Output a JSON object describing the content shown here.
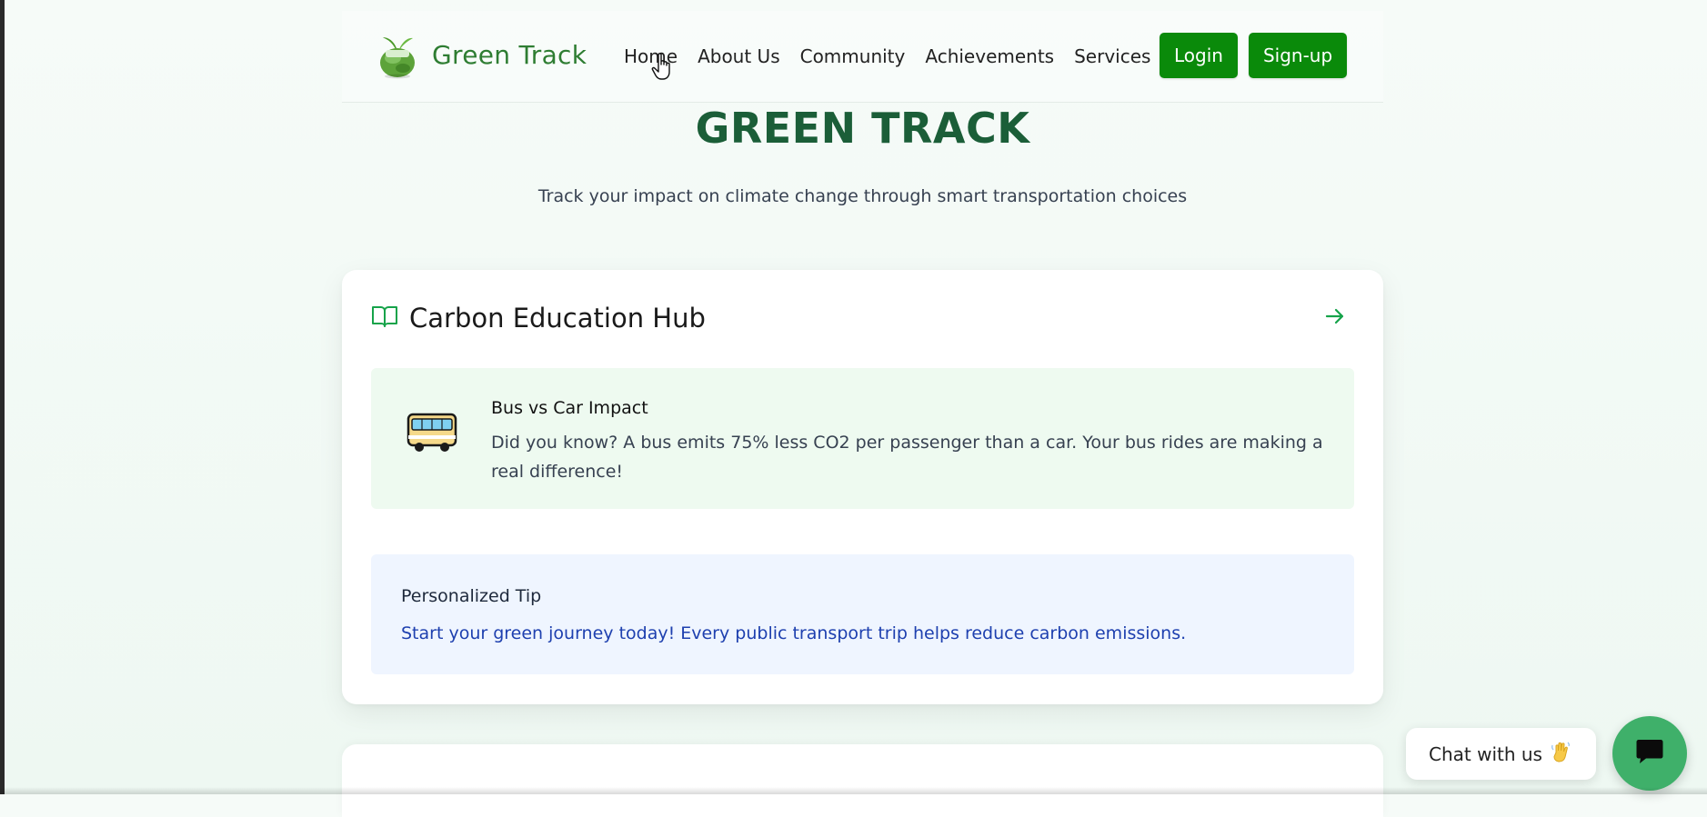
{
  "brand": {
    "name": "Green Track"
  },
  "nav": {
    "links": [
      "Home",
      "About Us",
      "Community",
      "Achievements",
      "Services"
    ],
    "login_label": "Login",
    "signup_label": "Sign-up"
  },
  "hero": {
    "title": "GREEN TRACK",
    "subtitle": "Track your impact on climate change through smart transportation choices"
  },
  "education_hub": {
    "title": "Carbon Education Hub",
    "fact": {
      "title": "Bus vs Car Impact",
      "text": "Did you know? A bus emits 75% less CO2 per passenger than a car. Your bus rides are making a real difference!"
    },
    "tip": {
      "title": "Personalized Tip",
      "text": "Start your green journey today! Every public transport trip helps reduce carbon emissions."
    }
  },
  "chat": {
    "label": "Chat with us"
  },
  "icons": {
    "logo": "globe-leaf-logo",
    "book": "book-open-icon",
    "arrow": "arrow-right-icon",
    "bus": "bus-icon",
    "wave": "waving-hand-icon",
    "chat": "chat-bubble-icon",
    "cursor": "hand-pointer-cursor"
  },
  "colors": {
    "brand_green": "#2e7d32",
    "button_green": "#0a8a0a",
    "title_green": "#1b5e38",
    "fact_bg": "#eefaf0",
    "tip_bg": "#eff5ff",
    "tip_text": "#1e40af",
    "chat_fab": "#3fb06a"
  }
}
